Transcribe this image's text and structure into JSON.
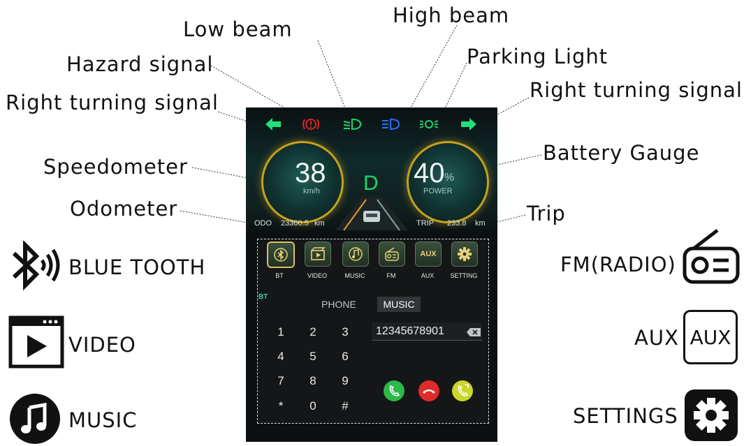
{
  "callouts": {
    "high_beam": "High beam",
    "low_beam": "Low beam",
    "parking_light": "Parking Light",
    "hazard_signal": "Hazard signal",
    "right_turning_signal_left": "Right turning signal",
    "right_turning_signal_right": "Right turning signal",
    "battery_gauge": "Battery Gauge",
    "speedometer": "Speedometer",
    "odometer": "Odometer",
    "trip": "Trip"
  },
  "legend": {
    "bluetooth": {
      "label": "BLUE TOOTH",
      "icon": "bluetooth-icon"
    },
    "video": {
      "label": "VIDEO",
      "icon": "video-icon"
    },
    "music": {
      "label": "MUSIC",
      "icon": "music-icon"
    },
    "fm": {
      "label": "FM(RADIO)",
      "icon": "radio-icon"
    },
    "aux": {
      "label": "AUX",
      "icon_text": "AUX"
    },
    "settings": {
      "label": "SETTINGS",
      "icon": "gear-icon"
    }
  },
  "cluster": {
    "speed": "38",
    "speed_unit": "km/h",
    "battery": "40",
    "battery_unit": "%",
    "battery_label": "POWER",
    "gear": "D",
    "odo_label": "ODO",
    "odo_value": "23300.5",
    "odo_unit": "km",
    "trip_label": "TRIP",
    "trip_value": "233.8",
    "trip_unit": "km",
    "colors": {
      "turn": "#1fe07a",
      "hazard": "#e02020",
      "low_beam": "#22d36c",
      "high_beam": "#2a6cff",
      "parking": "#22d36c",
      "gauge_ring": "#c8a018"
    }
  },
  "menu": {
    "items": [
      {
        "label": "BT",
        "icon": "bluetooth-icon"
      },
      {
        "label": "VIDEO",
        "icon": "video-icon"
      },
      {
        "label": "MUSIC",
        "icon": "music-icon"
      },
      {
        "label": "FM",
        "icon": "radio-icon"
      },
      {
        "label": "AUX",
        "icon_text": "AUX"
      },
      {
        "label": "SETTING",
        "icon": "gear-icon"
      }
    ],
    "section_tag": "BT",
    "tabs": [
      "PHONE",
      "MUSIC"
    ],
    "active_tab": "MUSIC",
    "keypad": [
      "1",
      "2",
      "3",
      "4",
      "5",
      "6",
      "7",
      "8",
      "9",
      "*",
      "0",
      "#"
    ],
    "number": "12345678901"
  }
}
